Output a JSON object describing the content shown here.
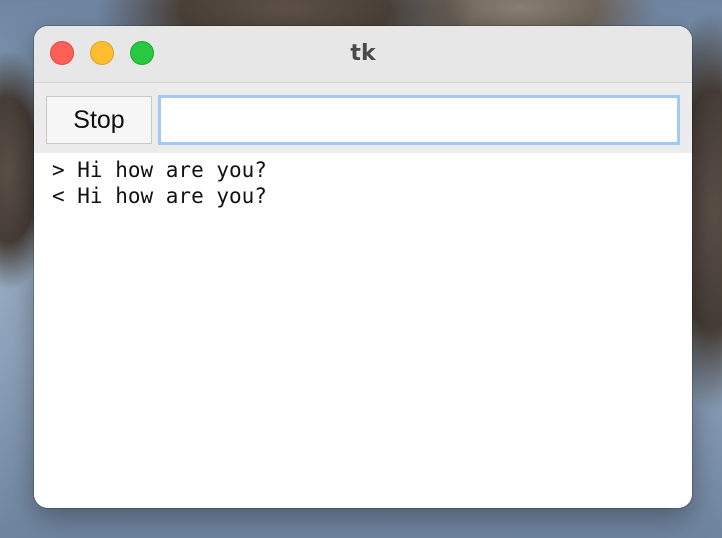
{
  "window": {
    "title": "tk"
  },
  "toolbar": {
    "stop_label": "Stop",
    "entry_value": ""
  },
  "output": {
    "lines": [
      "> Hi how are you?",
      "< Hi how are you?"
    ]
  }
}
